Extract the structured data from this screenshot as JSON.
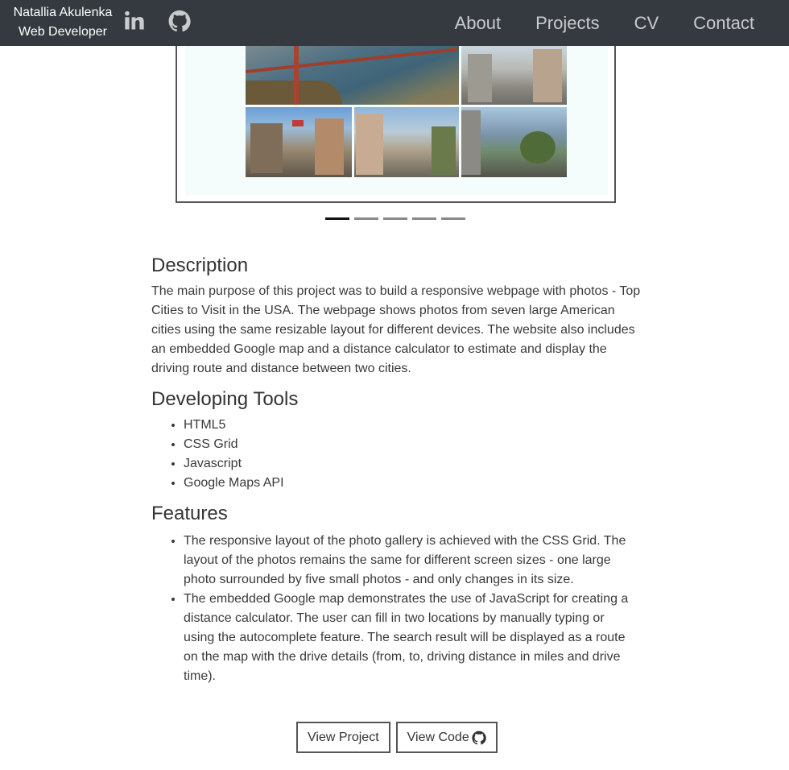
{
  "navbar": {
    "name": "Natallia Akulenka",
    "role": "Web Developer",
    "icons": [
      "linkedin-icon",
      "github-icon"
    ],
    "links": [
      "About",
      "Projects",
      "CV",
      "Contact"
    ]
  },
  "carousel": {
    "slides": 5,
    "active_slide": 1
  },
  "description": {
    "heading": "Description",
    "text": "The main purpose of this project was to build a responsive webpage with photos - Top Cities to Visit in the USA. The webpage shows photos from seven large American cities using the same resizable layout for different devices. The website also includes an embedded Google map and a distance calculator to estimate and display the driving route and distance between two cities."
  },
  "tools": {
    "heading": "Developing Tools",
    "items": [
      "HTML5",
      "CSS Grid",
      "Javascript",
      "Google Maps API"
    ]
  },
  "features": {
    "heading": "Features",
    "items": [
      "The responsive layout of the photo gallery is achieved with the CSS Grid. The layout of the photos remains the same for different screen sizes - one large photo surrounded by five small photos - and only changes in its size.",
      "The embedded Google map demonstrates the use of JavaScript for creating a distance calculator. The user can fill in two locations by manually typing or using the autocomplete feature. The search result will be displayed as a route on the map with the drive details (from, to, driving distance in miles and drive time)."
    ]
  },
  "buttons": {
    "view_project": "View Project",
    "view_code": "View Code",
    "code_icon": "github-icon"
  },
  "colors": {
    "navbar_bg": "#343a40",
    "nav_text": "#c9cbcd",
    "text": "#333333"
  }
}
